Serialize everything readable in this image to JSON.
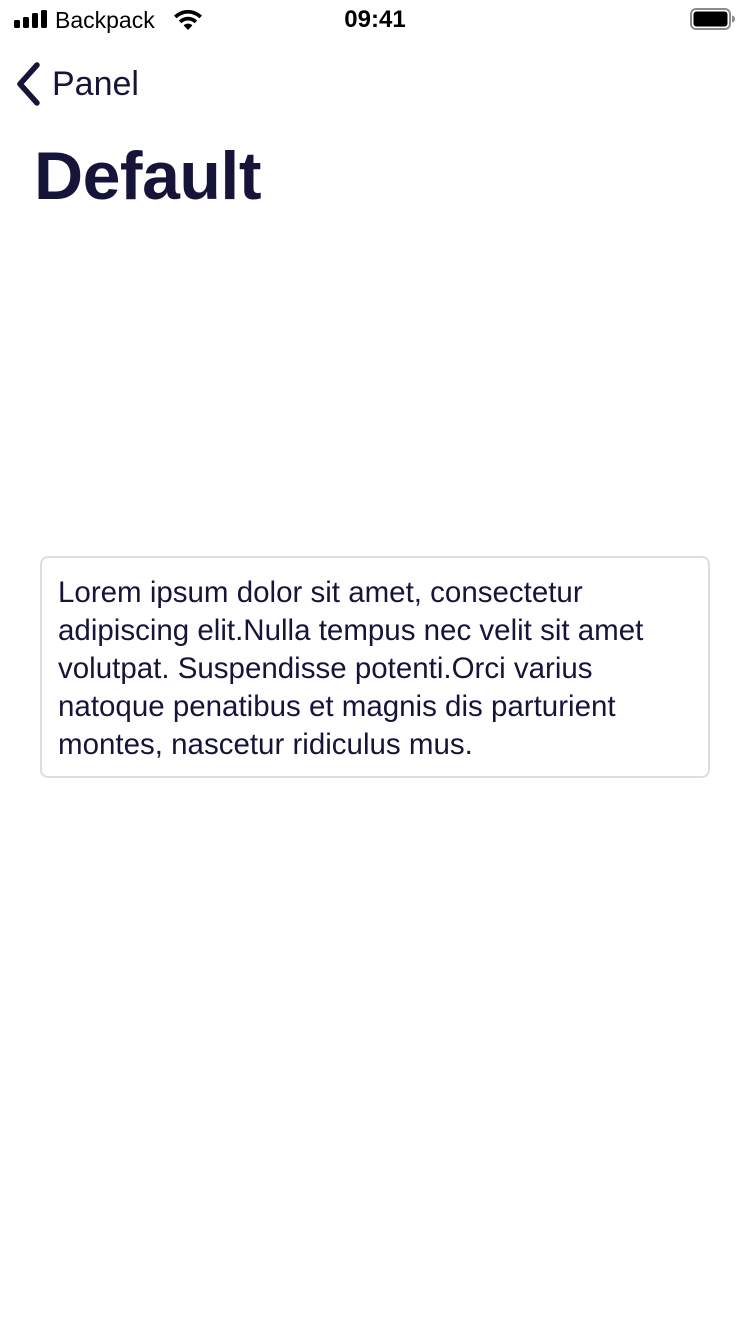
{
  "status_bar": {
    "carrier": "Backpack",
    "time": "09:41",
    "icons": [
      "signal-bars-icon",
      "wifi-icon",
      "battery-icon"
    ]
  },
  "nav": {
    "back_label": "Panel",
    "back_icon": "chevron-left-icon"
  },
  "page": {
    "title": "Default"
  },
  "panel": {
    "text": "Lorem ipsum dolor sit amet, consectetur adipiscing elit.Nulla tempus nec velit sit amet volutpat. Suspendisse potenti.Orci varius natoque penatibus et magnis dis parturient montes, nascetur ridiculus mus."
  },
  "colors": {
    "text_primary": "#161539",
    "panel_border": "#dddde5",
    "background": "#ffffff"
  }
}
